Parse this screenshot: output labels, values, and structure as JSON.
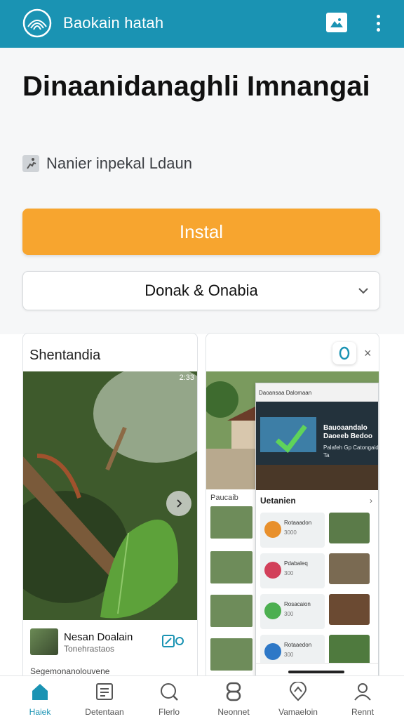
{
  "topbar": {
    "app_title": "Baokain hatah",
    "logo_icon": "shell-logo-icon",
    "image_button_icon": "image-icon",
    "menu_icon": "kebab-menu-icon",
    "color": "#1a93b3"
  },
  "hero": {
    "title": "Dinaanidanaghli Imnangai",
    "subtitle": "Nanier inpekal Ldaun",
    "subtitle_icon": "runner-icon",
    "install_label": "Instal",
    "install_color": "#f7a52f",
    "dropdown_value": "Donak & Onabia"
  },
  "card_left": {
    "title": "Shentandia",
    "status_text": "2:33",
    "author_name": "Nesan Doalain",
    "author_sub": "Tonehrastaos",
    "footer_text": "Segemonanolouvene"
  },
  "card_right": {
    "close_label": "×",
    "left_label": "Paucaib",
    "inner": {
      "bar_text": "Daoansaa Dalomaan",
      "hero_title": "Bauoaandalo Daoeeb Bedoo",
      "hero_text": "Palafeh Gp Catongaid Ta",
      "section_title": "Uetanien",
      "items": [
        {
          "title": "Rotaaadon",
          "sub": "3000",
          "color": "#e8902c"
        },
        {
          "title": "Pdabaleq",
          "sub": "300",
          "color": "#d2405a"
        },
        {
          "title": "Rosacaion",
          "sub": "300",
          "color": "#4caf50"
        },
        {
          "title": "Rotaaedon",
          "sub": "300",
          "color": "#2e78c7"
        }
      ]
    }
  },
  "bottom_nav": [
    {
      "label": "Haiek",
      "icon": "home-icon",
      "active": true
    },
    {
      "label": "Detentaan",
      "icon": "document-icon",
      "active": false
    },
    {
      "label": "Flerlo",
      "icon": "search-icon",
      "active": false
    },
    {
      "label": "Neonnet",
      "icon": "link-icon",
      "active": false
    },
    {
      "label": "Vamaeloin",
      "icon": "location-icon",
      "active": false
    },
    {
      "label": "Rennt",
      "icon": "profile-icon",
      "active": false
    }
  ]
}
